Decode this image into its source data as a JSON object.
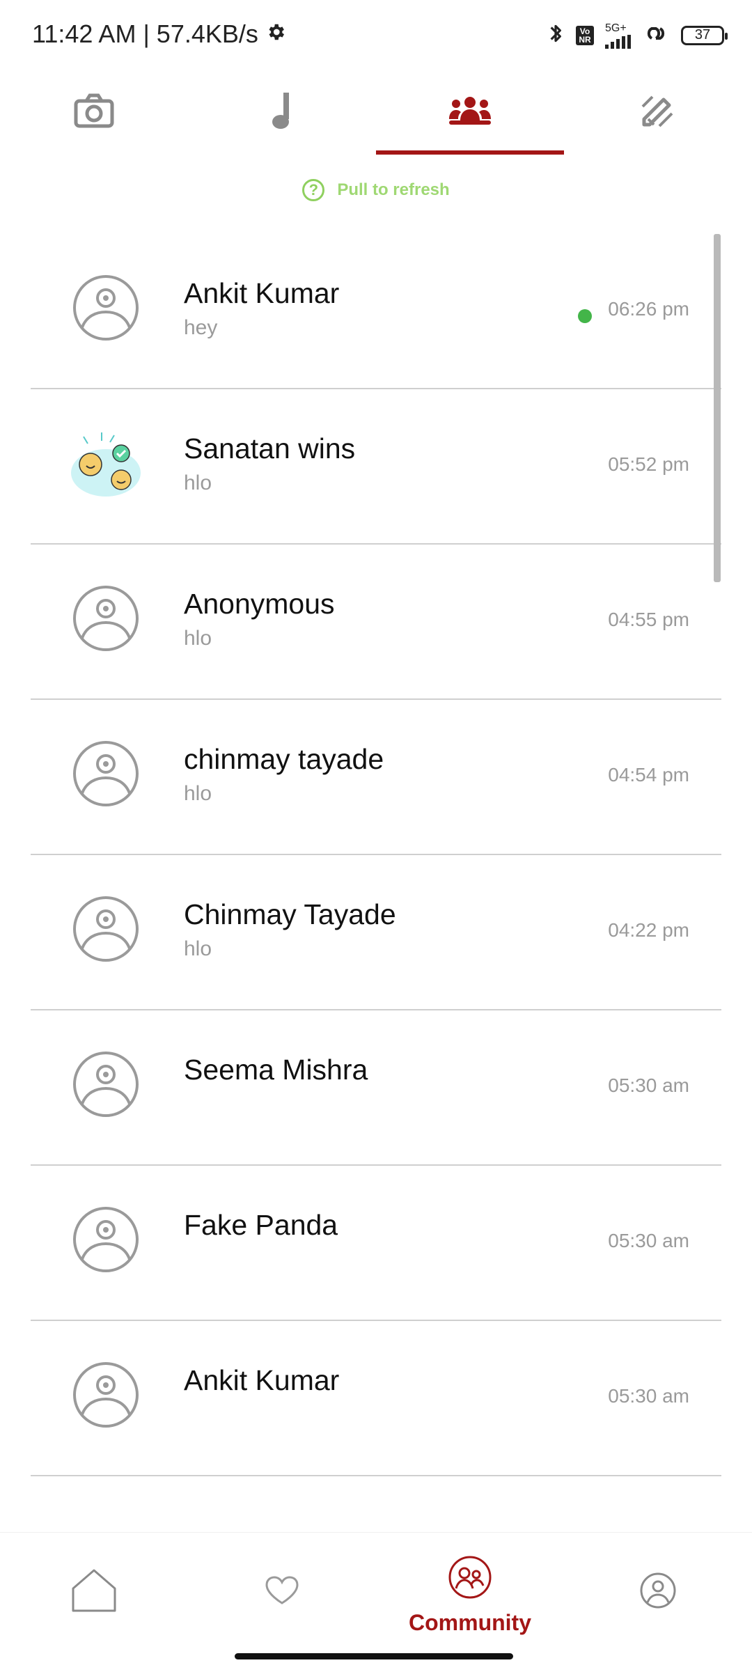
{
  "status_bar": {
    "time": "11:42 AM",
    "separator": "|",
    "speed": "57.4KB/s",
    "network": "5G+",
    "volte": "Vo NR",
    "battery": "37"
  },
  "top_tabs": [
    {
      "icon": "camera-icon",
      "active": false
    },
    {
      "icon": "music-note-icon",
      "active": false
    },
    {
      "icon": "group-icon",
      "active": true
    },
    {
      "icon": "edit-icon",
      "active": false
    }
  ],
  "refresh": {
    "icon": "?",
    "label": "Pull to refresh"
  },
  "chats": [
    {
      "name": "Ankit Kumar",
      "preview": "hey",
      "time": "06:26 pm",
      "online": true,
      "avatar": "default-avatar"
    },
    {
      "name": "Sanatan wins",
      "preview": "hlo",
      "time": "05:52 pm",
      "online": false,
      "avatar": "sticker-avatar"
    },
    {
      "name": "Anonymous",
      "preview": "hlo",
      "time": "04:55 pm",
      "online": false,
      "avatar": "default-avatar"
    },
    {
      "name": "chinmay tayade",
      "preview": "hlo",
      "time": "04:54 pm",
      "online": false,
      "avatar": "default-avatar"
    },
    {
      "name": "Chinmay Tayade",
      "preview": "hlo",
      "time": "04:22 pm",
      "online": false,
      "avatar": "default-avatar"
    },
    {
      "name": "Seema Mishra",
      "preview": "",
      "time": "05:30 am",
      "online": false,
      "avatar": "default-avatar"
    },
    {
      "name": "Fake Panda",
      "preview": "",
      "time": "05:30 am",
      "online": false,
      "avatar": "default-avatar"
    },
    {
      "name": "Ankit Kumar",
      "preview": "",
      "time": "05:30 am",
      "online": false,
      "avatar": "default-avatar"
    }
  ],
  "bottom_nav": [
    {
      "icon": "home-icon",
      "label": "",
      "active": false
    },
    {
      "icon": "heart-icon",
      "label": "",
      "active": false
    },
    {
      "icon": "community-icon",
      "label": "Community",
      "active": true
    },
    {
      "icon": "profile-icon",
      "label": "",
      "active": false
    }
  ],
  "colors": {
    "accent": "#a31616",
    "online": "#43b549",
    "refresh": "#9fd873",
    "muted": "#9a9a9a",
    "divider": "#cfcfcf"
  }
}
